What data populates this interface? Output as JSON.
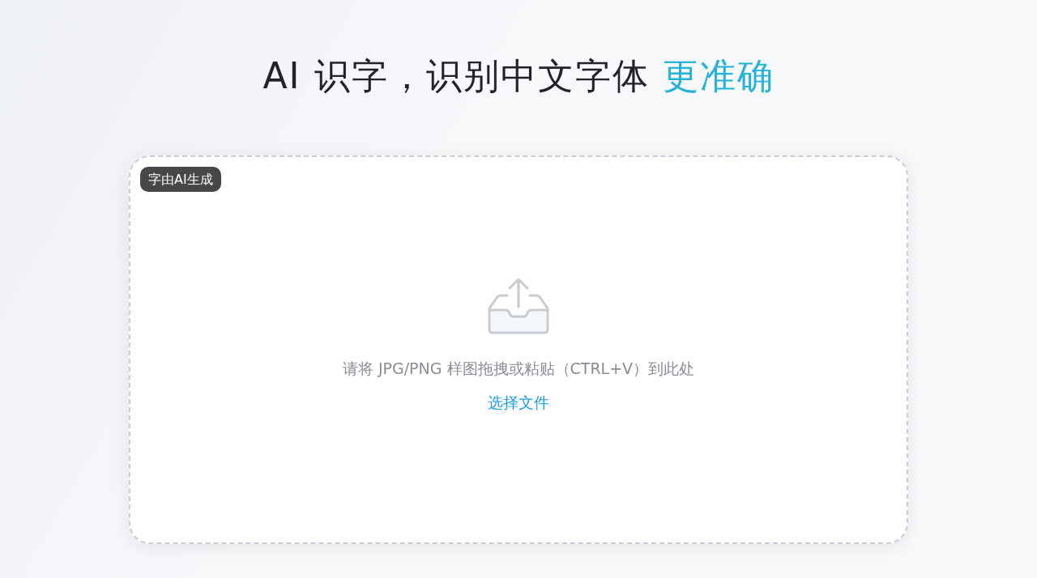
{
  "headline": {
    "text": "AI 识字，识别中文字体",
    "highlight": "更准确"
  },
  "upload": {
    "badge": "字由AI生成",
    "instruction": "请将 JPG/PNG 样图拖拽或粘贴（CTRL+V）到此处",
    "link": "选择文件"
  }
}
